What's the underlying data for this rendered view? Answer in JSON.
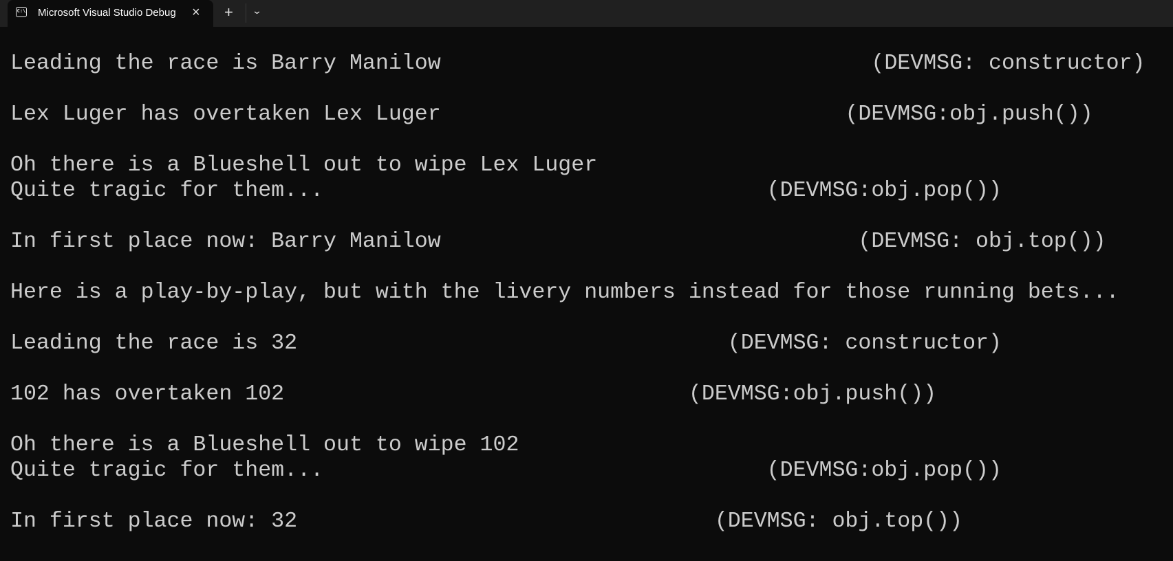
{
  "window": {
    "tab_title": "Microsoft Visual Studio Debug Console",
    "tab_icon": "console-icon",
    "close_icon": "×",
    "new_tab_icon": "+",
    "dropdown_icon": "⌄"
  },
  "terminal": {
    "lines": [
      {
        "text": "Leading the race is Barry Manilow",
        "dev": "(DEVMSG: constructor)"
      },
      {
        "text": "Lex Luger has overtaken Lex Luger",
        "dev": "(DEVMSG:obj.push())"
      },
      {
        "text": "Oh there is a Blueshell out to wipe Lex Luger",
        "dev": ""
      },
      {
        "text": "Quite tragic for them...",
        "dev": "(DEVMSG:obj.pop())"
      },
      {
        "text": "In first place now: Barry Manilow",
        "dev": "(DEVMSG: obj.top())"
      },
      {
        "text": "Here is a play-by-play, but with the livery numbers instead for those running bets...",
        "dev": ""
      },
      {
        "text": "Leading the race is 32",
        "dev": "(DEVMSG: constructor)"
      },
      {
        "text": "102 has overtaken 102",
        "dev": "(DEVMSG:obj.push())"
      },
      {
        "text": "Oh there is a Blueshell out to wipe 102",
        "dev": ""
      },
      {
        "text": "Quite tragic for them...",
        "dev": "(DEVMSG:obj.pop())"
      },
      {
        "text": "In first place now: 32",
        "dev": "(DEVMSG: obj.top())"
      }
    ]
  }
}
